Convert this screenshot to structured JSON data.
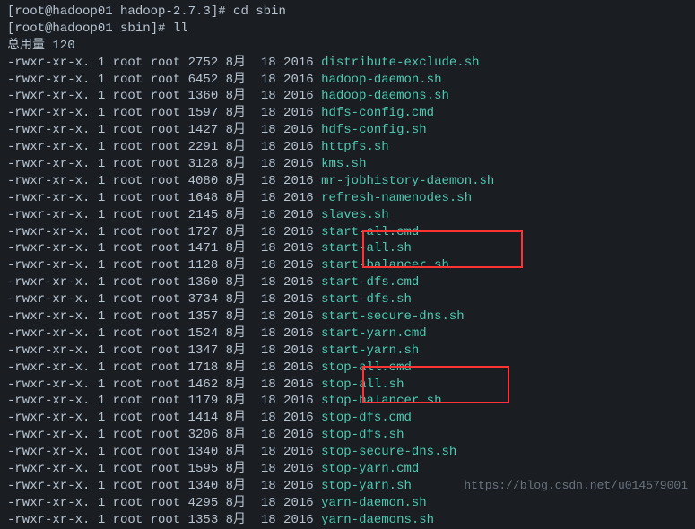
{
  "prompt1": "[root@hadoop01 hadoop-2.7.3]# cd sbin",
  "prompt2": "[root@hadoop01 sbin]# ll",
  "total": "总用量 120",
  "rows": [
    {
      "perm": "-rwxr-xr-x. 1 root root 2752 8月  18 2016 ",
      "file": "distribute-exclude.sh"
    },
    {
      "perm": "-rwxr-xr-x. 1 root root 6452 8月  18 2016 ",
      "file": "hadoop-daemon.sh"
    },
    {
      "perm": "-rwxr-xr-x. 1 root root 1360 8月  18 2016 ",
      "file": "hadoop-daemons.sh"
    },
    {
      "perm": "-rwxr-xr-x. 1 root root 1597 8月  18 2016 ",
      "file": "hdfs-config.cmd"
    },
    {
      "perm": "-rwxr-xr-x. 1 root root 1427 8月  18 2016 ",
      "file": "hdfs-config.sh"
    },
    {
      "perm": "-rwxr-xr-x. 1 root root 2291 8月  18 2016 ",
      "file": "httpfs.sh"
    },
    {
      "perm": "-rwxr-xr-x. 1 root root 3128 8月  18 2016 ",
      "file": "kms.sh"
    },
    {
      "perm": "-rwxr-xr-x. 1 root root 4080 8月  18 2016 ",
      "file": "mr-jobhistory-daemon.sh"
    },
    {
      "perm": "-rwxr-xr-x. 1 root root 1648 8月  18 2016 ",
      "file": "refresh-namenodes.sh"
    },
    {
      "perm": "-rwxr-xr-x. 1 root root 2145 8月  18 2016 ",
      "file": "slaves.sh"
    },
    {
      "perm": "-rwxr-xr-x. 1 root root 1727 8月  18 2016 ",
      "file": "start-all.cmd"
    },
    {
      "perm": "-rwxr-xr-x. 1 root root 1471 8月  18 2016 ",
      "file": "start-all.sh"
    },
    {
      "perm": "-rwxr-xr-x. 1 root root 1128 8月  18 2016 ",
      "file": "start-balancer.sh"
    },
    {
      "perm": "-rwxr-xr-x. 1 root root 1360 8月  18 2016 ",
      "file": "start-dfs.cmd"
    },
    {
      "perm": "-rwxr-xr-x. 1 root root 3734 8月  18 2016 ",
      "file": "start-dfs.sh"
    },
    {
      "perm": "-rwxr-xr-x. 1 root root 1357 8月  18 2016 ",
      "file": "start-secure-dns.sh"
    },
    {
      "perm": "-rwxr-xr-x. 1 root root 1524 8月  18 2016 ",
      "file": "start-yarn.cmd"
    },
    {
      "perm": "-rwxr-xr-x. 1 root root 1347 8月  18 2016 ",
      "file": "start-yarn.sh"
    },
    {
      "perm": "-rwxr-xr-x. 1 root root 1718 8月  18 2016 ",
      "file": "stop-all.cmd"
    },
    {
      "perm": "-rwxr-xr-x. 1 root root 1462 8月  18 2016 ",
      "file": "stop-all.sh"
    },
    {
      "perm": "-rwxr-xr-x. 1 root root 1179 8月  18 2016 ",
      "file": "stop-balancer.sh"
    },
    {
      "perm": "-rwxr-xr-x. 1 root root 1414 8月  18 2016 ",
      "file": "stop-dfs.cmd"
    },
    {
      "perm": "-rwxr-xr-x. 1 root root 3206 8月  18 2016 ",
      "file": "stop-dfs.sh"
    },
    {
      "perm": "-rwxr-xr-x. 1 root root 1340 8月  18 2016 ",
      "file": "stop-secure-dns.sh"
    },
    {
      "perm": "-rwxr-xr-x. 1 root root 1595 8月  18 2016 ",
      "file": "stop-yarn.cmd"
    },
    {
      "perm": "-rwxr-xr-x. 1 root root 1340 8月  18 2016 ",
      "file": "stop-yarn.sh"
    },
    {
      "perm": "-rwxr-xr-x. 1 root root 4295 8月  18 2016 ",
      "file": "yarn-daemon.sh"
    },
    {
      "perm": "-rwxr-xr-x. 1 root root 1353 8月  18 2016 ",
      "file": "yarn-daemons.sh"
    }
  ],
  "watermark": "https://blog.csdn.net/u014579001"
}
